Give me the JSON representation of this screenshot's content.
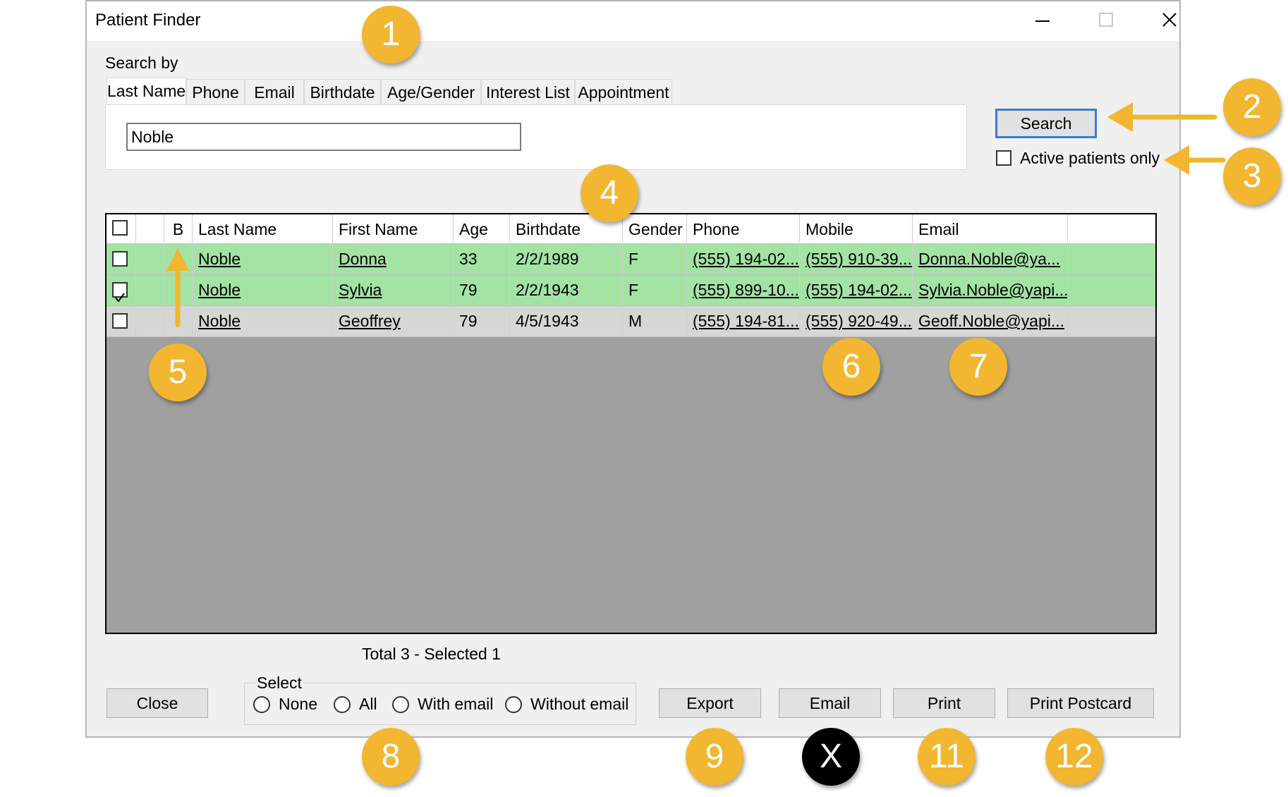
{
  "window": {
    "title": "Patient Finder"
  },
  "search": {
    "search_by_label": "Search by",
    "tabs": [
      {
        "label": "Last Name",
        "active": true
      },
      {
        "label": "Phone",
        "active": false
      },
      {
        "label": "Email",
        "active": false
      },
      {
        "label": "Birthdate",
        "active": false
      },
      {
        "label": "Age/Gender",
        "active": false
      },
      {
        "label": "Interest List",
        "active": false
      },
      {
        "label": "Appointment",
        "active": false
      }
    ],
    "input_value": "Noble",
    "search_button": "Search",
    "active_only_label": "Active patients only",
    "active_only_checked": false
  },
  "grid": {
    "columns": [
      "",
      "",
      "B",
      "Last Name",
      "First Name",
      "Age",
      "Birthdate",
      "Gender",
      "Phone",
      "Mobile",
      "Email",
      ""
    ],
    "rows": [
      {
        "checked": false,
        "last": "Noble",
        "first": "Donna",
        "age": "33",
        "birthdate": "2/2/1989",
        "gender": "F",
        "phone": "(555) 194-02...",
        "mobile": "(555) 910-39...",
        "email": "Donna.Noble@ya...",
        "color": "#a3e3a3"
      },
      {
        "checked": true,
        "last": "Noble",
        "first": "Sylvia",
        "age": "79",
        "birthdate": "2/2/1943",
        "gender": "F",
        "phone": "(555) 899-10...",
        "mobile": "(555) 194-02...",
        "email": "Sylvia.Noble@yapi...",
        "color": "#a3e3a3"
      },
      {
        "checked": false,
        "last": "Noble",
        "first": "Geoffrey",
        "age": "79",
        "birthdate": "4/5/1943",
        "gender": "M",
        "phone": "(555) 194-81...",
        "mobile": "(555) 920-49...",
        "email": "Geoff.Noble@yapi...",
        "color": "#d6d6d6"
      }
    ]
  },
  "footer": {
    "status": "Total 3  -  Selected 1",
    "close_button": "Close",
    "select_group_label": "Select",
    "select_options": [
      "None",
      "All",
      "With email",
      "Without email"
    ],
    "export_button": "Export",
    "email_button": "Email",
    "print_button": "Print",
    "postcard_button": "Print Postcard"
  },
  "callouts": [
    "1",
    "2",
    "3",
    "4",
    "5",
    "6",
    "7",
    "8",
    "9",
    "X",
    "11",
    "12"
  ],
  "colors": {
    "callout": "#f2b630",
    "row_highlight": "#a3e3a3",
    "row_plain": "#d6d6d6",
    "grid_background": "#a0a0a0",
    "focus_border": "#3d7ad6"
  }
}
